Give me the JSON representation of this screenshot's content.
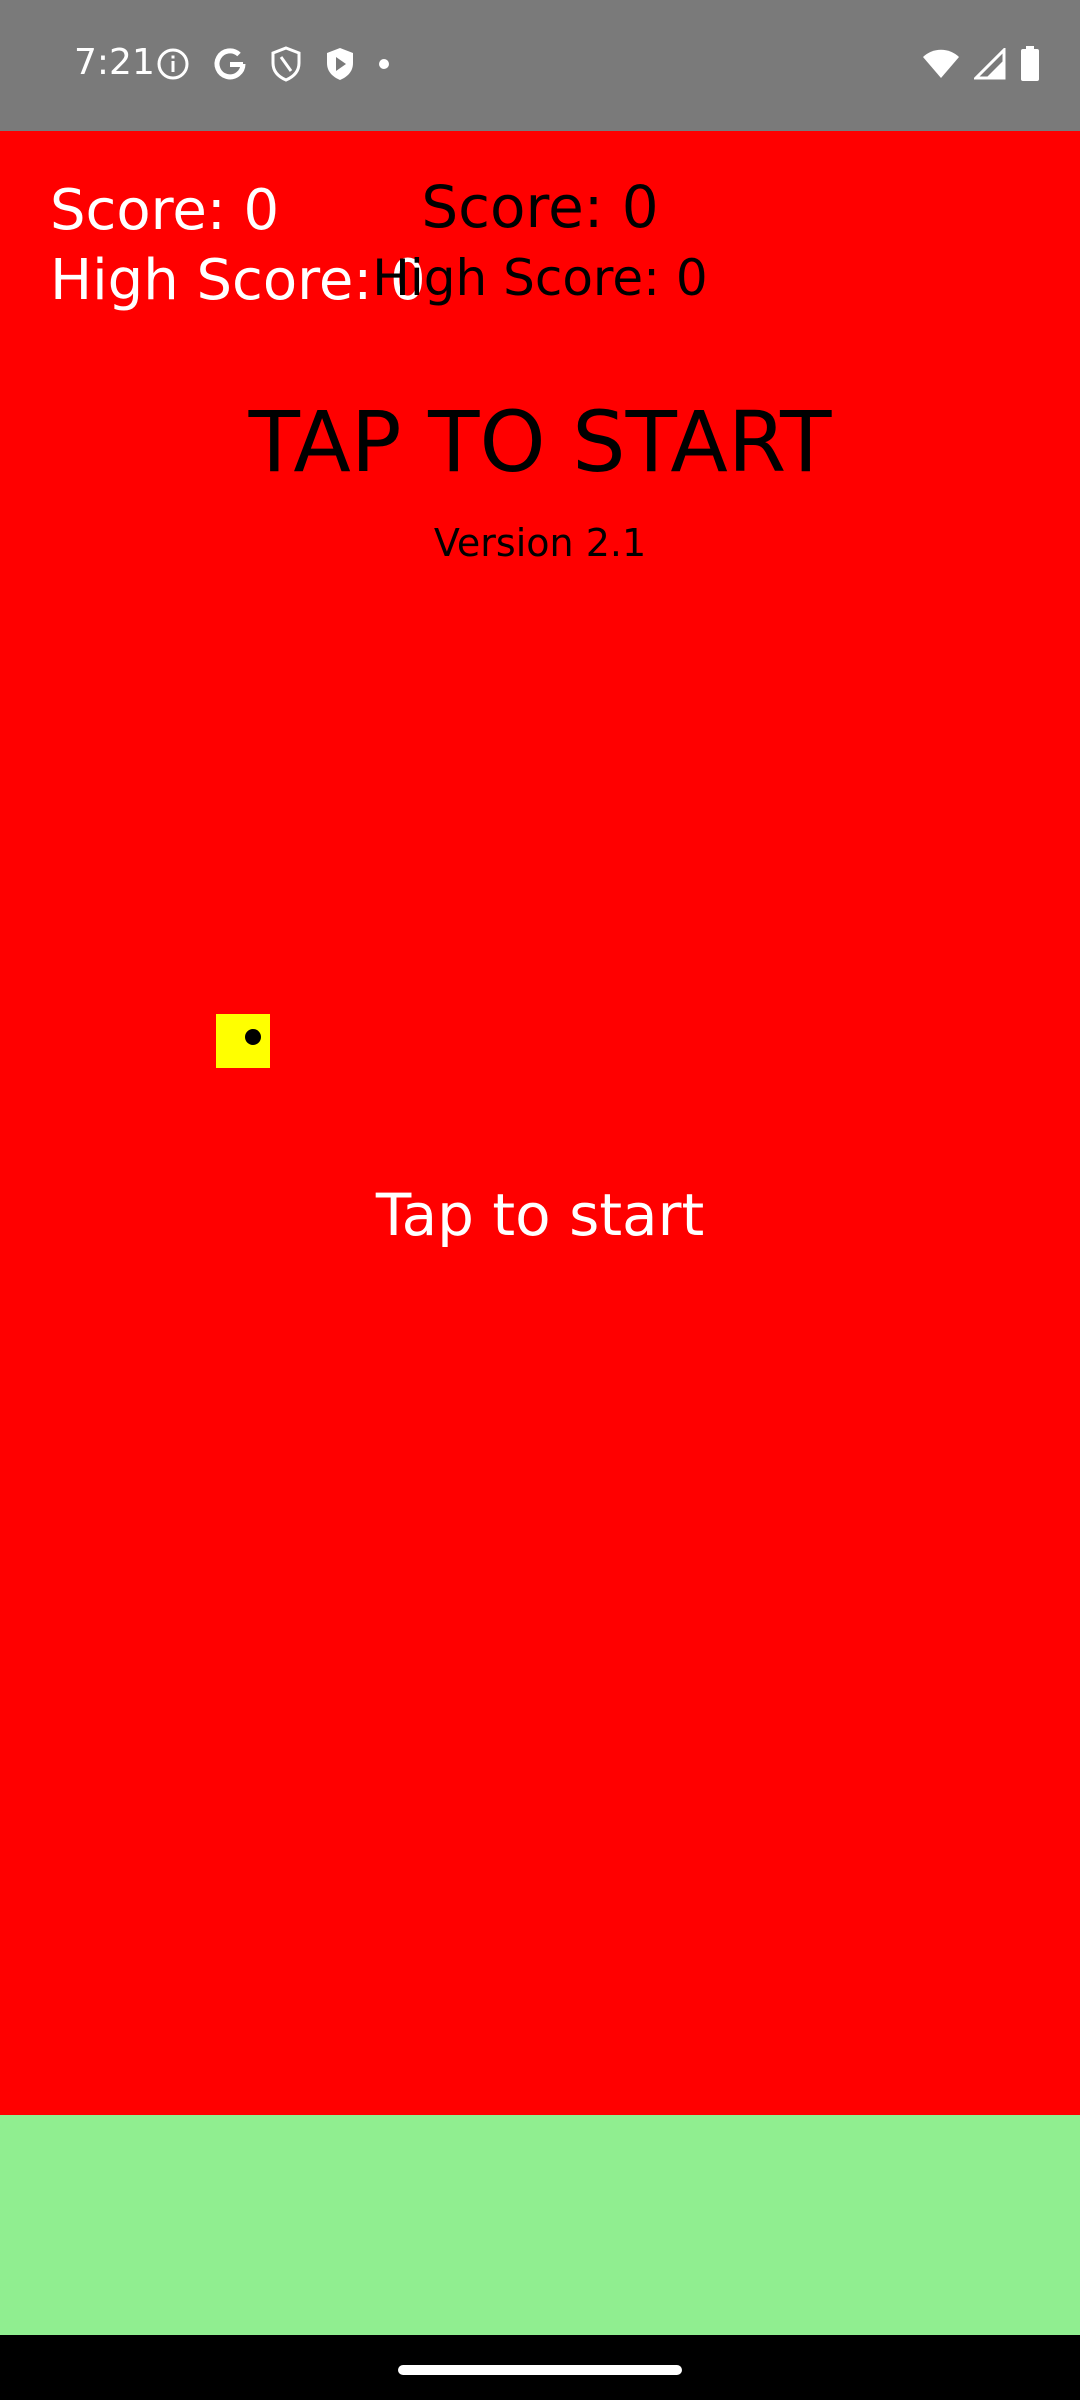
{
  "status_bar": {
    "time": "7:21",
    "left_icons": [
      "info-icon",
      "google-icon",
      "shield-icon",
      "play-protect-icon",
      "dot-icon"
    ],
    "right_icons": [
      "wifi-icon",
      "signal-icon",
      "battery-icon"
    ]
  },
  "hud": {
    "score_label": "Score: 0",
    "high_score_label": "High Score: 0",
    "center_score_label": "Score: 0",
    "center_high_score_label": "High Score: 0"
  },
  "title": {
    "text": "TAP TO START",
    "version": "Version 2.1"
  },
  "hint": {
    "text": "Tap to start"
  },
  "colors": {
    "sky": "#ff0000",
    "ground": "#90ee90",
    "player": "#ffff00",
    "status_bar": "#7a7a7a",
    "nav_bar": "#000000"
  }
}
